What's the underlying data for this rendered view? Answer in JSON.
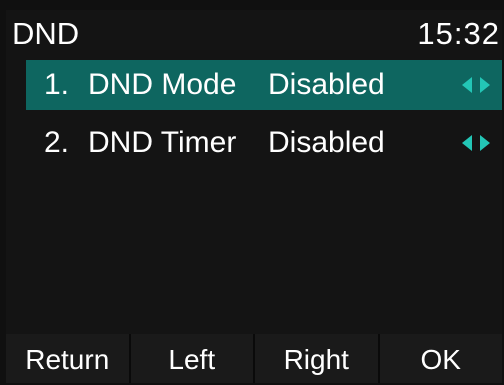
{
  "status_bar": {
    "title": "DND",
    "time": "15:32"
  },
  "menu": {
    "items": [
      {
        "index": "1.",
        "label": "DND Mode",
        "value": "Disabled",
        "selected": true
      },
      {
        "index": "2.",
        "label": "DND Timer",
        "value": "Disabled",
        "selected": false
      }
    ]
  },
  "softkeys": {
    "return_label": "Return",
    "left_label": "Left",
    "right_label": "Right",
    "ok_label": "OK"
  },
  "colors": {
    "background": "#141414",
    "selection": "#0e6660",
    "arrow": "#23c6b6",
    "text": "#ffffff"
  },
  "icons": {
    "value_switcher": "left-right-arrows-icon"
  }
}
